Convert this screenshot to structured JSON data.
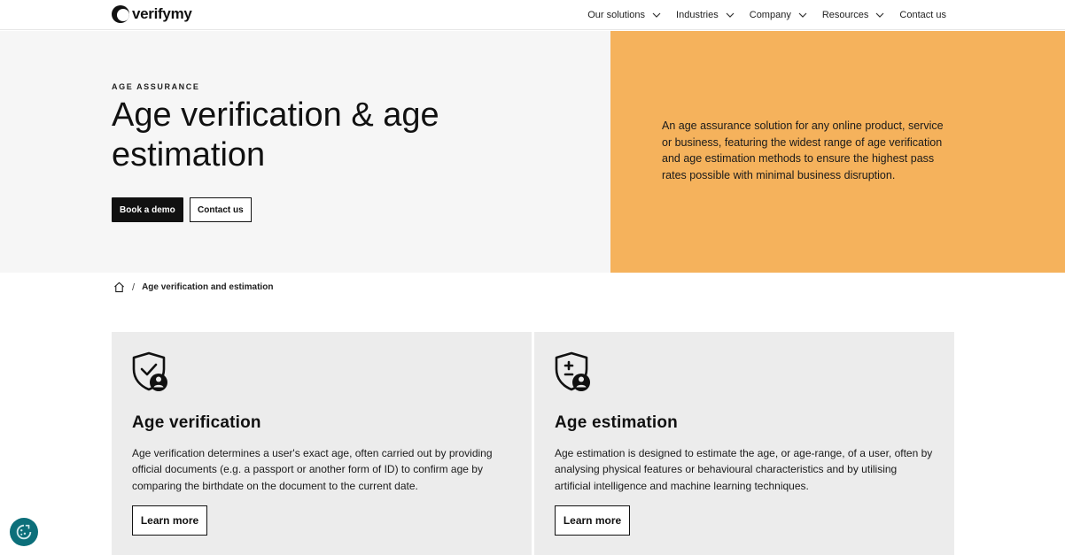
{
  "header": {
    "brand": "verifymy",
    "nav": [
      {
        "label": "Our solutions",
        "has_dropdown": true
      },
      {
        "label": "Industries",
        "has_dropdown": true
      },
      {
        "label": "Company",
        "has_dropdown": true
      },
      {
        "label": "Resources",
        "has_dropdown": true
      },
      {
        "label": "Contact us",
        "has_dropdown": false
      }
    ]
  },
  "hero": {
    "eyebrow": "AGE ASSURANCE",
    "title": "Age verification & age estimation",
    "primary_button": "Book a demo",
    "secondary_button": "Contact us",
    "description": "An age assurance solution for any online product, service or business, featuring the widest range of age verification and age estimation methods to ensure the highest pass rates possible with minimal business disruption.",
    "accent_color": "#f5b25c"
  },
  "breadcrumb": {
    "separator": "/",
    "current": "Age verification and estimation"
  },
  "cards": [
    {
      "icon": "shield-check-user-icon",
      "title": "Age verification",
      "text": "Age verification determines a user's exact age, often carried out by providing official documents (e.g. a passport or another form of ID) to confirm age by comparing the birthdate on the document to the current date.",
      "button": "Learn more"
    },
    {
      "icon": "shield-plus-user-icon",
      "title": "Age estimation",
      "text": "Age estimation is designed to estimate the age, or age-range, of a user, often by analysing physical features or behavioural characteristics and by utilising artificial intelligence and machine learning techniques.",
      "button": "Learn more"
    }
  ]
}
